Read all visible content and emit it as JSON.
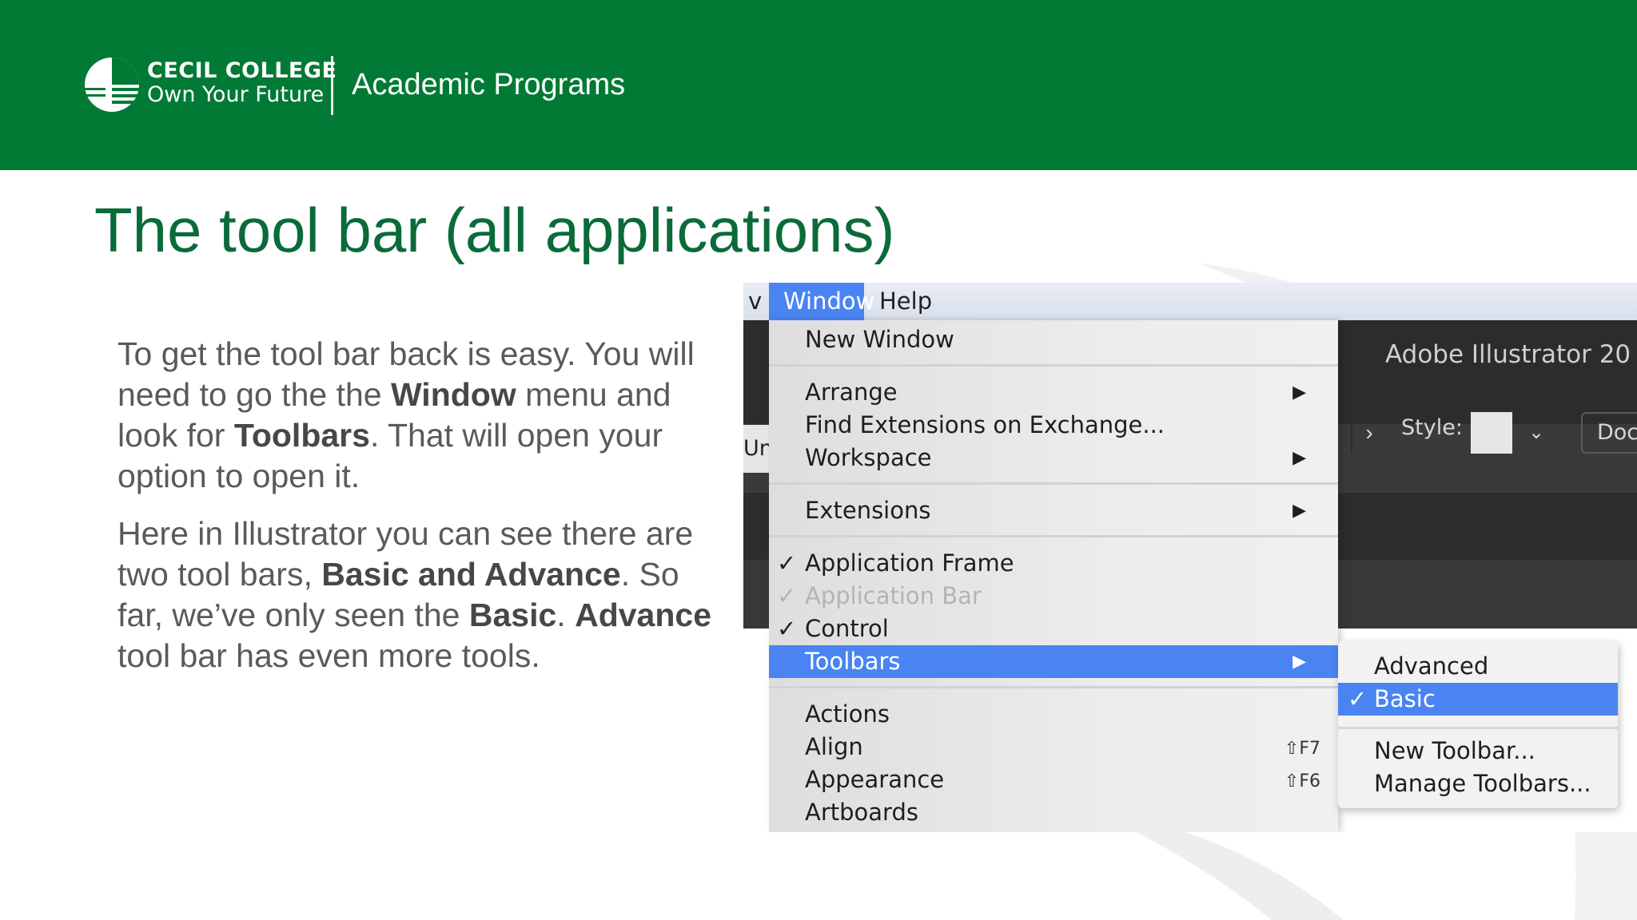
{
  "header": {
    "brand_name": "CECIL COLLEGE",
    "brand_tagline": "Own Your Future",
    "section": "Academic Programs",
    "background_color": "#017a36"
  },
  "slide": {
    "title": "The tool bar (all applications)",
    "paragraph1": {
      "t1": "To get the tool bar back is easy. You will need to go the the ",
      "b1": "Window",
      "t2": " menu and look for ",
      "b2": "Toolbars",
      "t3": ". That will open your option to open it."
    },
    "paragraph2": {
      "t1": "Here in Illustrator you can see there are two tool bars, ",
      "b1": "Basic and Advance",
      "t2": ". So far, we’ve only seen the ",
      "b2": "Basic",
      "t3": ". ",
      "b3": "Advance",
      "t4": " tool bar has even more tools."
    }
  },
  "screenshot": {
    "menubar": {
      "partial_item": "v",
      "window": "Window",
      "help": "Help"
    },
    "app_title": "Adobe Illustrator 20",
    "control_bar": {
      "partial_left": "Un",
      "style_label": "Style:",
      "doc_button": "Doc"
    },
    "window_menu": {
      "new_window": "New Window",
      "arrange": "Arrange",
      "find_extensions": "Find Extensions on Exchange...",
      "workspace": "Workspace",
      "extensions": "Extensions",
      "application_frame": "Application Frame",
      "application_bar": "Application Bar",
      "control": "Control",
      "toolbars": "Toolbars",
      "actions": "Actions",
      "align": "Align",
      "align_shortcut": "⇧F7",
      "appearance": "Appearance",
      "appearance_shortcut": "⇧F6",
      "artboards": "Artboards",
      "check_glyph": "✓",
      "arrow_glyph": "▶"
    },
    "toolbars_submenu": {
      "advanced": "Advanced",
      "basic": "Basic",
      "new_toolbar": "New Toolbar...",
      "manage_toolbars": "Manage Toolbars..."
    },
    "highlight_color": "#4a84f2"
  }
}
